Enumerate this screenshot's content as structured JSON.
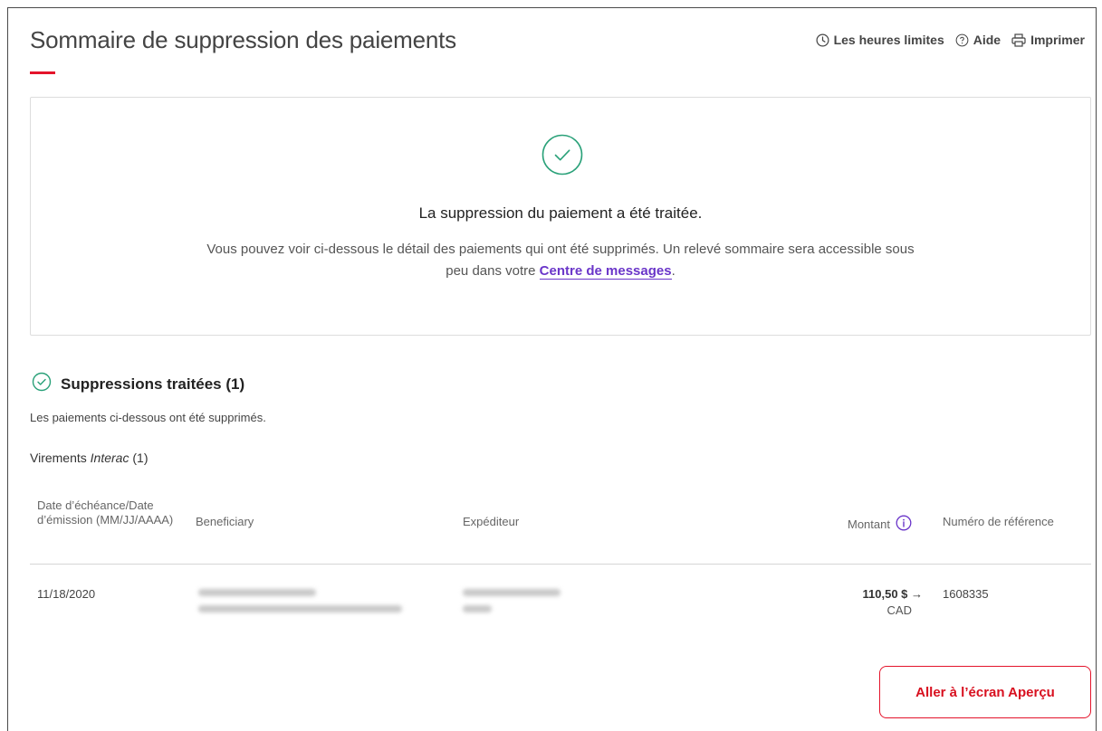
{
  "header": {
    "title": "Sommaire de suppression des paiements",
    "links": {
      "cutoff_label": "Les heures limites",
      "help_label": "Aide",
      "print_label": "Imprimer"
    }
  },
  "success": {
    "title": "La suppression du paiement a été traitée.",
    "text_before": "Vous pouvez voir ci-dessous le détail des paiements qui ont été supprimés. Un relevé sommaire sera accessible sous peu dans votre ",
    "link_label": "Centre de messages",
    "text_after": "."
  },
  "section": {
    "title": "Suppressions traitées (1)",
    "description": "Les paiements ci-dessous ont été supprimés.",
    "subhead_prefix": "Virements ",
    "subhead_italic": "Interac",
    "subhead_count": " (1)"
  },
  "table": {
    "headers": {
      "date": "Date d’échéance/Date d’émission (MM/JJ/AAAA)",
      "beneficiary": "Beneficiary",
      "sender": "Expéditeur",
      "amount": "Montant",
      "reference": "Numéro de référence"
    },
    "rows": [
      {
        "date": "11/18/2020",
        "amount": "110,50 $ →",
        "currency": "CAD",
        "reference": "1608335"
      }
    ]
  },
  "actions": {
    "overview_button": "Aller à l’écran Aperçu"
  },
  "colors": {
    "accent_red": "#e4142b",
    "success_green": "#2aa179",
    "link_purple": "#6a35c9"
  }
}
